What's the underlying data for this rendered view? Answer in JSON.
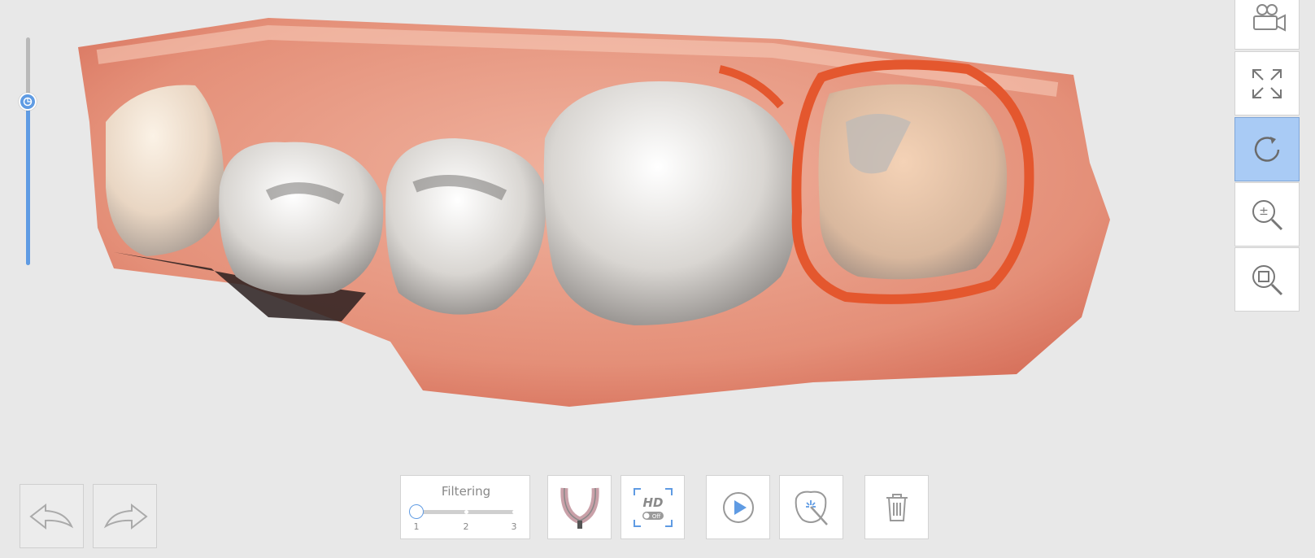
{
  "toolbar_right": {
    "items": [
      {
        "id": "video",
        "icon": "video-camera-icon"
      },
      {
        "id": "fit",
        "icon": "fit-screen-icon"
      },
      {
        "id": "rotate",
        "icon": "rotate-icon",
        "active": true
      },
      {
        "id": "zoom-pm",
        "icon": "zoom-plus-minus-icon"
      },
      {
        "id": "zoom-box",
        "icon": "zoom-box-icon"
      }
    ]
  },
  "filtering": {
    "title": "Filtering",
    "ticks": [
      "1",
      "2",
      "3"
    ],
    "value": 1
  },
  "bottom_tools": [
    {
      "id": "arch",
      "icon": "dental-arch-icon"
    },
    {
      "id": "hd",
      "icon": "hd-toggle-icon",
      "hd_label": "HD",
      "toggle_label": "Off"
    },
    {
      "id": "play",
      "icon": "play-icon"
    },
    {
      "id": "magic",
      "icon": "tooth-magic-wand-icon"
    },
    {
      "id": "delete",
      "icon": "trash-icon"
    }
  ],
  "navigation": {
    "undo_icon": "undo-arrow-icon",
    "redo_icon": "redo-arrow-icon"
  },
  "vertical_slider": {
    "value_fraction": 0.72
  },
  "colors": {
    "accent": "#5f9be3",
    "active_tool": "#a9cbf5",
    "background": "#e8e8e8"
  }
}
